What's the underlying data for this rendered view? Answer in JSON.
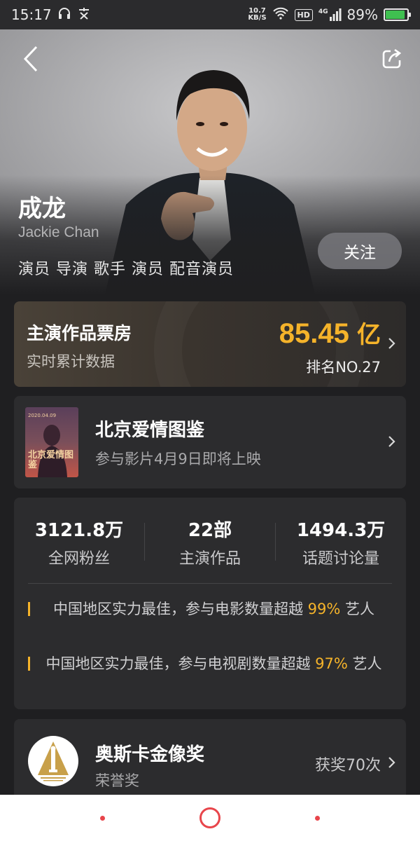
{
  "status_bar": {
    "time": "15:17",
    "net_speed_value": "10.7",
    "net_speed_unit": "KB/S",
    "hd": "HD",
    "signal": "4G",
    "battery_percent_text": "89%",
    "battery_level": 0.89
  },
  "header": {
    "back_icon": "chevron-left-icon",
    "share_icon": "share-icon"
  },
  "profile": {
    "name": "成龙",
    "english_name": "Jackie Chan",
    "roles": "演员 导演 歌手 演员 配音演员",
    "follow_label": "关注"
  },
  "box_office": {
    "title": "主演作品票房",
    "subtitle": "实时累计数据",
    "value": "85.45",
    "unit": "亿",
    "rank": "排名NO.27"
  },
  "movie": {
    "title": "北京爱情图鉴",
    "subtitle": "参与影片4月9日即将上映",
    "poster_title": "北京爱情图鉴",
    "poster_date": "2020.04.09"
  },
  "stats": [
    {
      "value": "3121.8万",
      "label": "全网粉丝"
    },
    {
      "value": "22部",
      "label": "主演作品"
    },
    {
      "value": "1494.3万",
      "label": "话题讨论量"
    }
  ],
  "honors": [
    {
      "text_before": "中国地区实力最佳，参与电影数量超越 ",
      "percent": "99%",
      "text_after": " 艺人"
    },
    {
      "text_before": "中国地区实力最佳，参与电视剧数量超越 ",
      "percent": "97%",
      "text_after": " 艺人"
    }
  ],
  "award": {
    "title": "奥斯卡金像奖",
    "subtitle": "荣誉奖",
    "count": "获奖70次"
  },
  "colors": {
    "accent": "#f5b32a",
    "background": "#1f1f21",
    "card": "#2c2c2e",
    "nav_accent": "#e8454b"
  }
}
